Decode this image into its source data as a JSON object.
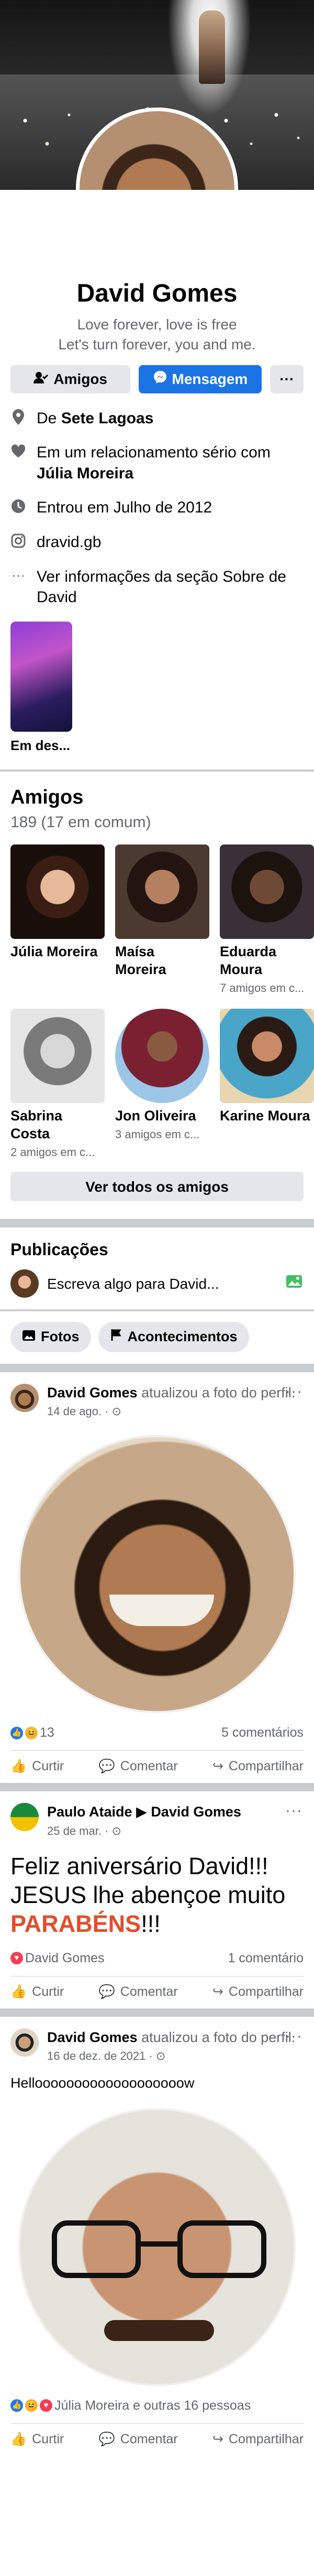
{
  "profile": {
    "name": "David Gomes",
    "bio_line1": "Love forever, love is free",
    "bio_line2": "Let's turn forever, you and me."
  },
  "buttons": {
    "friends": "Amigos",
    "message": "Mensagem",
    "more": "···"
  },
  "info": {
    "city_prefix": "De ",
    "city": "Sete Lagoas",
    "relationship_prefix": "Em um relacionamento sério com ",
    "relationship_partner": "Júlia Moreira",
    "joined": "Entrou em Julho de 2012",
    "instagram": "dravid.gb",
    "see_about": "Ver informações da seção Sobre de David"
  },
  "featured": {
    "label": "Em des..."
  },
  "friends": {
    "title": "Amigos",
    "count": "189 (17 em comum)",
    "list": [
      {
        "name": "Júlia Moreira",
        "mutual": ""
      },
      {
        "name": "Maísa Moreira",
        "mutual": ""
      },
      {
        "name": "Eduarda Moura",
        "mutual": "7 amigos em c..."
      },
      {
        "name": "Sabrina Costa",
        "mutual": "2 amigos em c..."
      },
      {
        "name": "Jon Oliveira",
        "mutual": "3 amigos em c..."
      },
      {
        "name": "Karine Moura",
        "mutual": ""
      }
    ],
    "see_all": "Ver todos os amigos"
  },
  "publications": {
    "title": "Publicações",
    "composer_placeholder": "Escreva algo para David...",
    "chip_photos": "Fotos",
    "chip_events": "Acontecimentos"
  },
  "posts": [
    {
      "author": "David Gomes",
      "action": " atualizou a foto do perfil.",
      "date": "14 de ago. · ",
      "reaction_count": "13",
      "comments": "5 comentários"
    },
    {
      "author": "Paulo Ataide",
      "arrow": " ▶ ",
      "target": "David Gomes",
      "date": "25 de mar. · ",
      "text": "Feliz aniversário David!!! JESUS lhe abençoe muito ",
      "text_red": "PARABÉNS",
      "text_end": "!!!",
      "reaction_name": "David Gomes",
      "comments": "1 comentário"
    },
    {
      "author": "David Gomes",
      "action": " atualizou a foto do perfil.",
      "date": "16 de dez. de 2021 · ",
      "caption": "Hellooooooooooooooooooow",
      "reactions_text": "Júlia Moreira e outras 16 pessoas"
    }
  ],
  "actions": {
    "like": "Curtir",
    "comment": "Comentar",
    "share": "Compartilhar"
  },
  "colors": {
    "accent": "#1b74e4",
    "red_text": "#e54c2b",
    "muted": "#65676b"
  }
}
